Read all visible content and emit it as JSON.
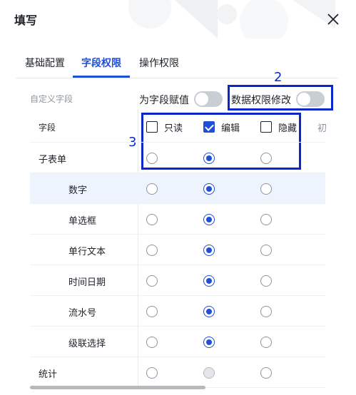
{
  "dialog": {
    "title": "填写"
  },
  "tabs": [
    {
      "label": "基础配置"
    },
    {
      "label": "字段权限",
      "active": true
    },
    {
      "label": "操作权限"
    }
  ],
  "toolbar": {
    "custom_fields_label": "自定义字段",
    "assign_label": "为字段赋值",
    "assign_enabled": false,
    "data_perm_label": "数据权限修改",
    "data_perm_enabled": false
  },
  "annotations": {
    "box2": "2",
    "box3": "3"
  },
  "table": {
    "field_header": "字段",
    "columns": [
      {
        "label": "只读",
        "checked": false
      },
      {
        "label": "编辑",
        "checked": true
      },
      {
        "label": "隐藏",
        "checked": false
      },
      {
        "label": "初"
      }
    ],
    "rows": [
      {
        "name": "子表单",
        "selected": 1
      },
      {
        "name": "数字",
        "selected": 1,
        "highlight": true
      },
      {
        "name": "单选框",
        "selected": 1
      },
      {
        "name": "单行文本",
        "selected": 1
      },
      {
        "name": "时间日期",
        "selected": 1
      },
      {
        "name": "流水号",
        "selected": 1
      },
      {
        "name": "级联选择",
        "selected": 1
      },
      {
        "name": "统计",
        "selected": null,
        "edit_disabled": true
      }
    ]
  },
  "colors": {
    "accent": "#1f4fd6",
    "annotation": "#0a27c8"
  }
}
